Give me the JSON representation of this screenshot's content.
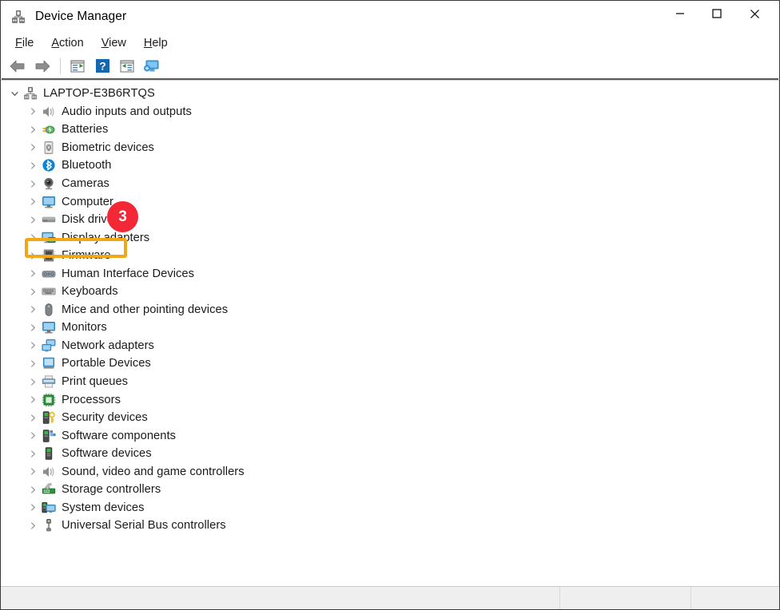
{
  "window": {
    "title": "Device Manager",
    "app_icon": "device-manager-icon",
    "controls": {
      "minimize": "minimize-icon",
      "maximize": "maximize-icon",
      "close": "close-icon"
    }
  },
  "menu": {
    "items": [
      {
        "accel": "F",
        "rest": "ile"
      },
      {
        "accel": "A",
        "rest": "ction"
      },
      {
        "accel": "V",
        "rest": "iew"
      },
      {
        "accel": "H",
        "rest": "elp"
      }
    ]
  },
  "toolbar": {
    "buttons": [
      {
        "name": "back-icon"
      },
      {
        "name": "forward-icon"
      },
      {
        "name": "separator"
      },
      {
        "name": "properties-icon"
      },
      {
        "name": "help-icon"
      },
      {
        "name": "scan-for-hardware-changes-icon"
      },
      {
        "name": "update-driver-icon"
      }
    ]
  },
  "tree": {
    "root": {
      "label": "LAPTOP-E3B6RTQS",
      "icon": "computer-root-icon",
      "expanded": true
    },
    "items": [
      {
        "label": "Audio inputs and outputs",
        "icon": "speaker-icon"
      },
      {
        "label": "Batteries",
        "icon": "battery-plug-icon"
      },
      {
        "label": "Biometric devices",
        "icon": "fingerprint-icon"
      },
      {
        "label": "Bluetooth",
        "icon": "bluetooth-icon",
        "highlighted": true
      },
      {
        "label": "Cameras",
        "icon": "camera-icon"
      },
      {
        "label": "Computer",
        "icon": "monitor-icon"
      },
      {
        "label": "Disk drives",
        "icon": "disk-drive-icon"
      },
      {
        "label": "Display adapters",
        "icon": "display-adapter-icon"
      },
      {
        "label": "Firmware",
        "icon": "chip-icon"
      },
      {
        "label": "Human Interface Devices",
        "icon": "hid-icon"
      },
      {
        "label": "Keyboards",
        "icon": "keyboard-icon"
      },
      {
        "label": "Mice and other pointing devices",
        "icon": "mouse-icon"
      },
      {
        "label": "Monitors",
        "icon": "monitor-icon"
      },
      {
        "label": "Network adapters",
        "icon": "network-adapter-icon"
      },
      {
        "label": "Portable Devices",
        "icon": "portable-device-icon"
      },
      {
        "label": "Print queues",
        "icon": "printer-icon"
      },
      {
        "label": "Processors",
        "icon": "processor-icon"
      },
      {
        "label": "Security devices",
        "icon": "security-key-icon"
      },
      {
        "label": "Software components",
        "icon": "software-component-icon"
      },
      {
        "label": "Software devices",
        "icon": "software-device-icon"
      },
      {
        "label": "Sound, video and game controllers",
        "icon": "speaker-icon"
      },
      {
        "label": "Storage controllers",
        "icon": "storage-controller-icon"
      },
      {
        "label": "System devices",
        "icon": "system-device-icon"
      },
      {
        "label": "Universal Serial Bus controllers",
        "icon": "usb-icon"
      }
    ]
  },
  "annotations": {
    "step_badge": "3",
    "highlight_color": "#f0a818",
    "badge_color": "#f32735"
  },
  "status_bar": {
    "main_text": "",
    "mid_text": "",
    "right_text": ""
  }
}
